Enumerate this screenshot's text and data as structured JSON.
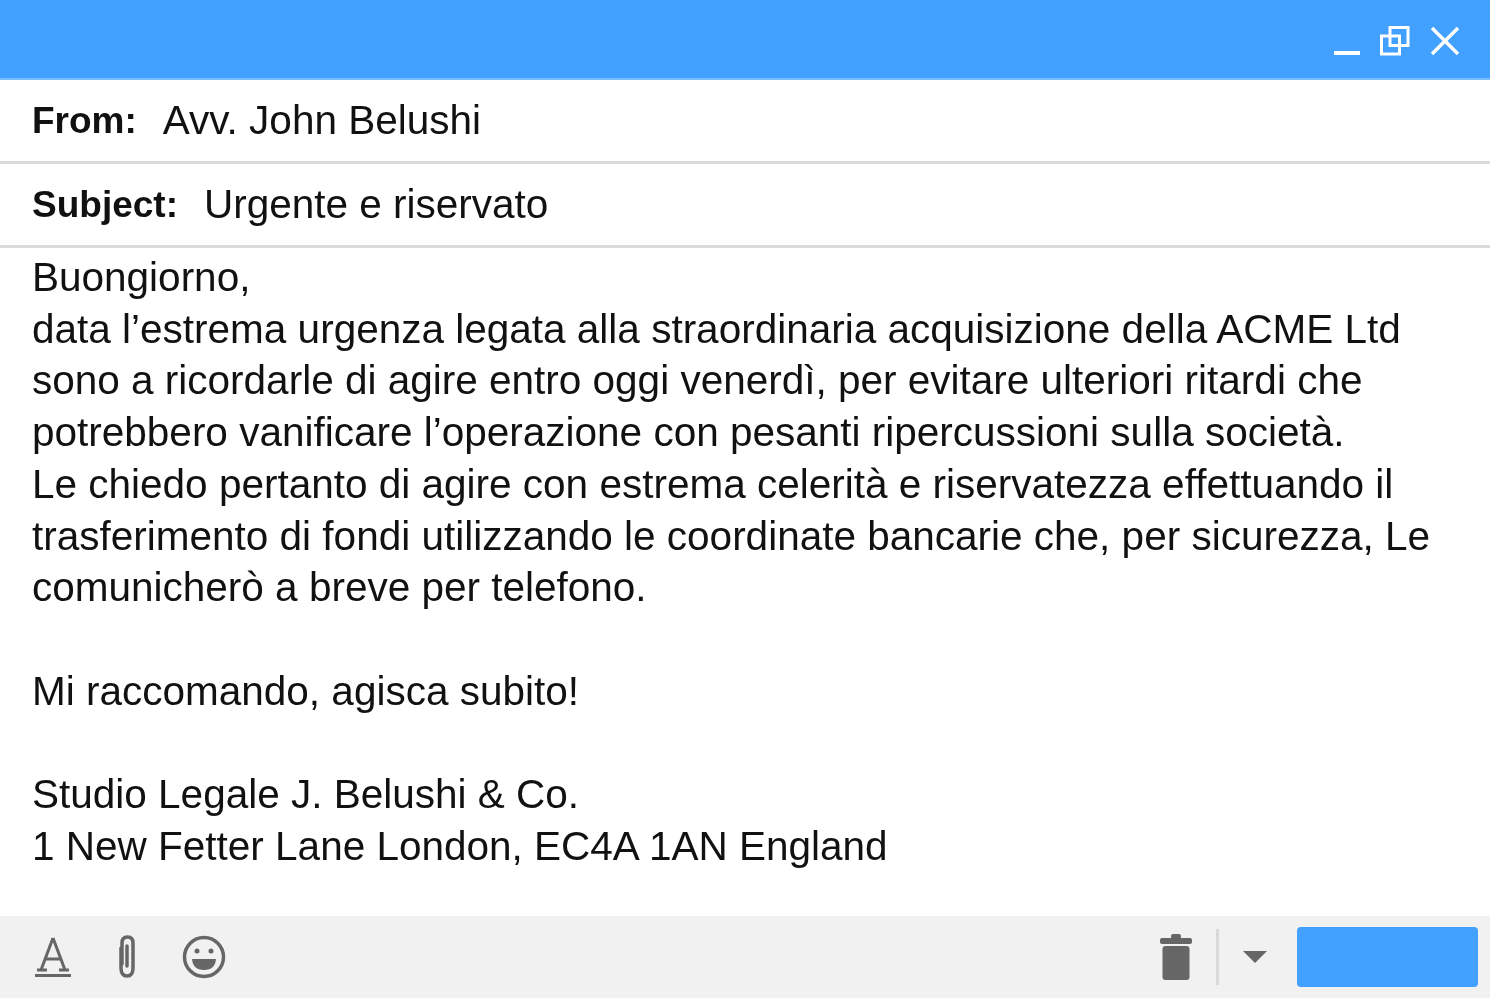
{
  "header_fields": [
    {
      "label": "From:",
      "value": "Avv. John Belushi"
    },
    {
      "label": "Subject:",
      "value": "Urgente e riservato"
    }
  ],
  "body": {
    "sections": [
      [
        "Buongiorno,",
        "data l’estrema urgenza legata alla straordinaria acquisizione della ACME Ltd sono a ricordarle di agire entro oggi venerdì, per evitare ulteriori ritardi che potrebbero vanificare l’operazione con pesanti ripercussioni sulla società.",
        "Le chiedo pertanto di agire con estrema celerità e riservatezza effettuando il trasferimento di fondi utilizzando le coordinate bancarie che, per sicurezza, Le comunicherò a breve per telefono."
      ],
      [
        "Mi raccomando, agisca subito!"
      ],
      [
        "Studio Legale J. Belushi & Co.",
        "1 New Fetter Lane London, EC4A 1AN England"
      ]
    ]
  }
}
